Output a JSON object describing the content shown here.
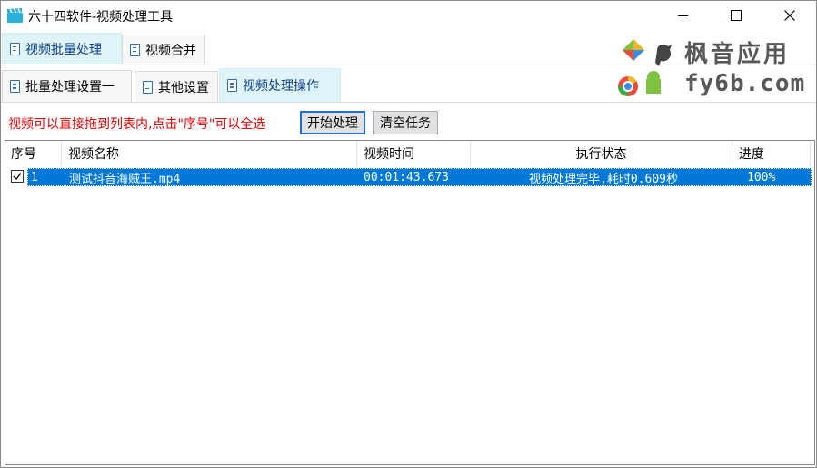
{
  "window": {
    "title": "六十四软件-视频处理工具",
    "minimize_glyph": "—",
    "maximize_glyph": "☐",
    "close_glyph": "✕"
  },
  "outer_tabs": [
    {
      "label": "视频批量处理",
      "active": true
    },
    {
      "label": "视频合并",
      "active": false
    }
  ],
  "inner_tabs": [
    {
      "label": "批量处理设置一",
      "active": false
    },
    {
      "label": "其他设置",
      "active": false
    },
    {
      "label": "视频处理操作",
      "active": true
    }
  ],
  "watermark": {
    "line1": "枫音应用",
    "line2": "fy6b.com"
  },
  "toolbar": {
    "hint": "视频可以直接拖到列表内,点击\"序号\"可以全选",
    "start_label": "开始处理",
    "clear_label": "清空任务"
  },
  "table": {
    "columns": [
      "序号",
      "视频名称",
      "视频时间",
      "执行状态",
      "进度"
    ],
    "rows": [
      {
        "checked": true,
        "index": "1",
        "name": "测试抖音海贼王.mp4",
        "duration": "00:01:43.673",
        "status": "视频处理完毕,耗时0.609秒",
        "progress": "100%"
      }
    ]
  },
  "colors": {
    "accent": "#0078d7",
    "hint_red": "#e60000",
    "active_tab_bg": "#dff4f8"
  }
}
